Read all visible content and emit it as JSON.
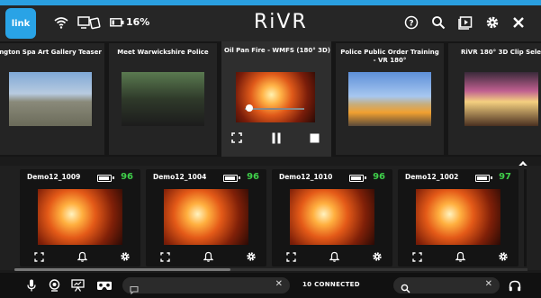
{
  "topbar": {
    "link_badge": "link",
    "battery": "16%",
    "logo": "RiVR",
    "icons": [
      "wifi-icon",
      "devices-icon",
      "battery-icon",
      "help-icon",
      "search-icon",
      "media-icon",
      "gear-icon",
      "close-icon"
    ]
  },
  "videos": [
    {
      "title": "ngton Spa Art Gallery Teaser",
      "thumb": "art"
    },
    {
      "title": "Meet Warwickshire Police",
      "thumb": "police"
    },
    {
      "title": "Oil Pan Fire - WMFS (180° 3D)",
      "thumb": "fire",
      "active": true,
      "progress": 0.08
    },
    {
      "title": "Police Public Order Training - VR 180°",
      "thumb": "order"
    },
    {
      "title": "RiVR 180° 3D Clip Selec",
      "thumb": "clip"
    }
  ],
  "headsets": [
    {
      "name": "Demo12_1009",
      "battery": "96",
      "level": 0.96
    },
    {
      "name": "Demo12_1004",
      "battery": "96",
      "level": 0.96
    },
    {
      "name": "Demo12_1010",
      "battery": "96",
      "level": 0.96
    },
    {
      "name": "Demo12_1002",
      "battery": "97",
      "level": 0.97
    }
  ],
  "bottombar": {
    "connected": "10 CONNECTED",
    "clear": "✕"
  },
  "colors": {
    "accent": "#2a9fe0",
    "battery_ok": "#3fcf4a",
    "background": "#1b1b1b"
  }
}
